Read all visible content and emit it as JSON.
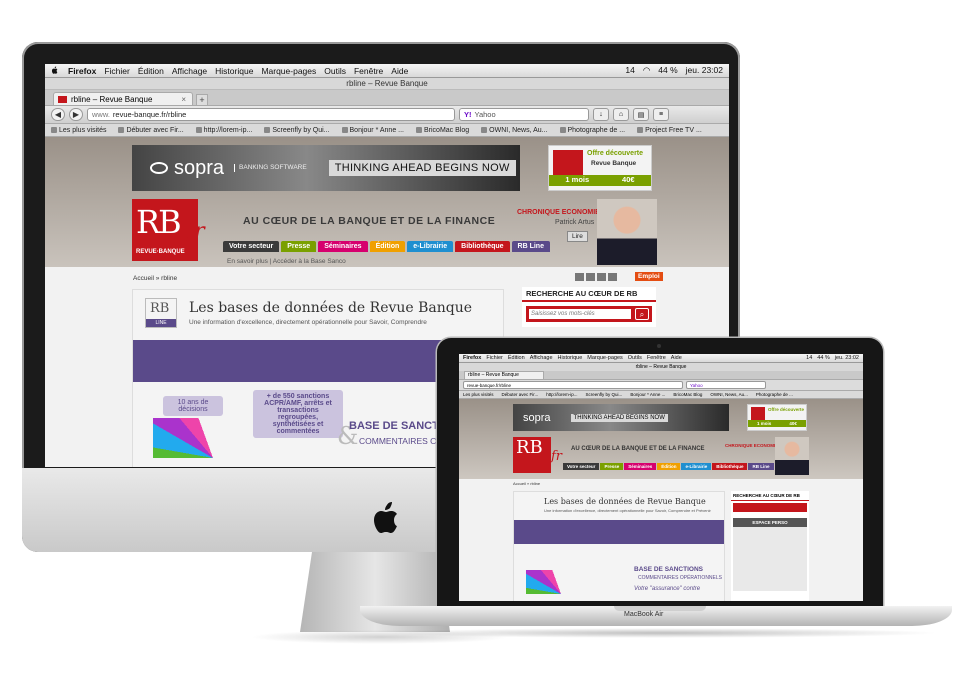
{
  "mac_menu": {
    "app": "Firefox",
    "items": [
      "Fichier",
      "Édition",
      "Affichage",
      "Historique",
      "Marque-pages",
      "Outils",
      "Fenêtre",
      "Aide"
    ],
    "status": [
      "14",
      "44 %",
      "jeu. 23:02"
    ]
  },
  "browser": {
    "window_title": "rbline – Revue Banque",
    "tab_label": "rbline – Revue Banque",
    "new_tab": "+",
    "url_prefix": "www.",
    "url": "revue-banque.fr/rbline",
    "search_engine": "Yahoo",
    "bookmarks": [
      "Les plus visités",
      "Débuter avec Fir...",
      "http://lorem-ip...",
      "Screenfly by Qui...",
      "Bonjour * Anne ...",
      "BricoMac Blog",
      "OWNI, News, Au...",
      "Photographe de ...",
      "Project Free TV ..."
    ]
  },
  "site": {
    "ad": {
      "brand": "sopra",
      "brand_sub": "BANKING SOFTWARE",
      "slogan": "THINKING AHEAD BEGINS NOW"
    },
    "offer": {
      "title": "Offre découverte",
      "subtitle": "Revue Banque",
      "duration": "1 mois",
      "price": "40€"
    },
    "logo": {
      "letters": "RB",
      "name": "REVUE·BANQUE",
      "suffix": "fr"
    },
    "tagline": "AU CŒUR DE LA BANQUE ET DE LA FINANCE",
    "chronique": {
      "label": "CHRONIQUE ECONOMIE",
      "author": "Patrick Artus",
      "button": "Lire"
    },
    "nav": [
      {
        "label": "Votre secteur",
        "color": "#3a3a3a"
      },
      {
        "label": "Presse",
        "color": "#7aa000"
      },
      {
        "label": "Séminaires",
        "color": "#d6006e"
      },
      {
        "label": "Édition",
        "color": "#f0a000"
      },
      {
        "label": "e-Librairie",
        "color": "#1f8fd0"
      },
      {
        "label": "Bibliothèque",
        "color": "#c4161c"
      },
      {
        "label": "RB Line",
        "color": "#5a4a8a"
      }
    ],
    "sublinks": "En savoir plus | Accéder à la Base Sanco",
    "breadcrumb": "Accueil » rbline",
    "emploi": "Emploi",
    "rbline_logo": {
      "top": "RB",
      "bottom": "LINE"
    },
    "card_title": "Les bases de données de Revue Banque",
    "card_sub": "Une information d'excellence, directement opérationnelle pour Savoir, Comprendre",
    "stat_a": "10 ans de décisions",
    "stat_b": "+ de 550 sanctions ACPR/AMF, arrêts et transactions regroupées, synthétisées et commentées",
    "base_title": "BASE DE SANCTIONS",
    "base_sub": "COMMENTAIRES OPÉRATIONNELS",
    "amp": "&",
    "search_title": "RECHERCHE AU CŒUR DE RB",
    "search_placeholder": "Saisissez vos mots-clés",
    "search_go": "⌕"
  },
  "macbook": {
    "label": "MacBook Air",
    "card_sub": "Une information d'excellence, directement opérationnelle pour Savoir, Comprendre et Prévenir",
    "assurance": "Votre \"assurance\" contre",
    "espace": "ESPACE PERSO"
  }
}
